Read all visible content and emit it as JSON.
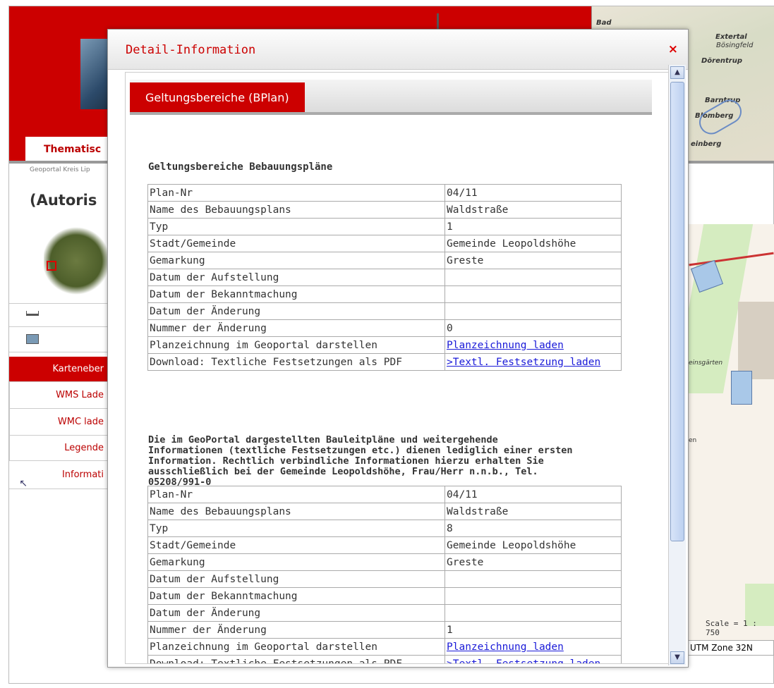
{
  "background": {
    "nav_tab": "Thematisc",
    "breadcrumb": "Geoportal Kreis Lip",
    "heading": "(Autoris",
    "sidebar": [
      {
        "label": "Karteneber",
        "active": true
      },
      {
        "label": "WMS Lade"
      },
      {
        "label": "WMC lade"
      },
      {
        "label": "Legende"
      },
      {
        "label": "Informati"
      }
    ],
    "map_thumb_labels": [
      "Bad",
      "Extertal",
      "Bösingfeld",
      "Dörentrup",
      "Barntrup",
      "Blomberg",
      "einberg"
    ],
    "map_labels": [
      "einsgärten",
      "en"
    ],
    "scale": "Scale = 1 : 750",
    "projection": "UTM Zone 32N"
  },
  "dialog": {
    "title": "Detail-Information",
    "close": "×",
    "tab": "Geltungsbereiche (BPlan)",
    "section_title": "Geltungsbereiche Bebauungspläne",
    "records": [
      {
        "rows": [
          {
            "key": "Plan-Nr",
            "value": "04/11"
          },
          {
            "key": "Name des Bebauungsplans",
            "value": "Waldstraße"
          },
          {
            "key": "Typ",
            "value": "1"
          },
          {
            "key": "Stadt/Gemeinde",
            "value": "Gemeinde Leopoldshöhe"
          },
          {
            "key": "Gemarkung",
            "value": "Greste"
          },
          {
            "key": "Datum der Aufstellung",
            "value": ""
          },
          {
            "key": "Datum der Bekanntmachung",
            "value": ""
          },
          {
            "key": "Datum der Änderung",
            "value": ""
          },
          {
            "key": "Nummer der Änderung",
            "value": "0"
          },
          {
            "key": "Planzeichnung im Geoportal darstellen",
            "value": "Planzeichnung laden",
            "link": true
          },
          {
            "key": "Download: Textliche Festsetzungen als PDF",
            "value": ">Textl. Festsetzung laden",
            "link": true
          }
        ]
      },
      {
        "rows": [
          {
            "key": "Plan-Nr",
            "value": "04/11"
          },
          {
            "key": "Name des Bebauungsplans",
            "value": "Waldstraße"
          },
          {
            "key": "Typ",
            "value": "8"
          },
          {
            "key": "Stadt/Gemeinde",
            "value": "Gemeinde Leopoldshöhe"
          },
          {
            "key": "Gemarkung",
            "value": "Greste"
          },
          {
            "key": "Datum der Aufstellung",
            "value": ""
          },
          {
            "key": "Datum der Bekanntmachung",
            "value": ""
          },
          {
            "key": "Datum der Änderung",
            "value": ""
          },
          {
            "key": "Nummer der Änderung",
            "value": "1"
          },
          {
            "key": "Planzeichnung im Geoportal darstellen",
            "value": "Planzeichnung laden",
            "link": true
          },
          {
            "key": "Download: Textliche Festsetzungen als PDF",
            "value": ">Textl. Festsetzung laden",
            "link": true
          }
        ]
      }
    ],
    "notice_lines": [
      "Die im GeoPortal dargestellten Bauleitpläne und weitergehende",
      "Informationen (textliche Festsetzungen etc.) dienen lediglich einer ersten",
      "Information. Rechtlich verbindliche Informationen hierzu erhalten Sie",
      "ausschließlich bei der Gemeinde Leopoldshöhe, Frau/Herr n.n.b., Tel.",
      "05208/991-0"
    ]
  },
  "colors": {
    "brand_red": "#cc0000",
    "link_blue": "#1a1ad8"
  }
}
